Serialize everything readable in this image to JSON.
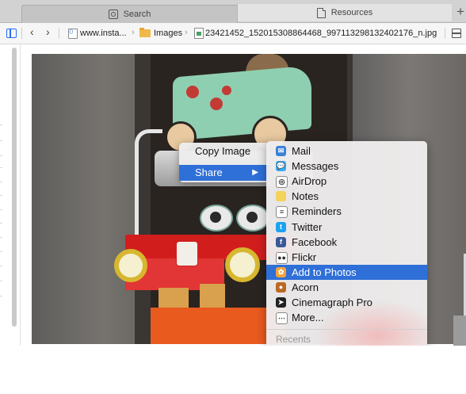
{
  "tabs": [
    {
      "label": "Search",
      "icon": "search-box-icon"
    },
    {
      "label": "Resources",
      "icon": "document-icon"
    }
  ],
  "new_tab_label": "+",
  "path": {
    "crumbs": [
      "www.insta...",
      "Images",
      "23421452_152015308864468_997113298132402176_n.jpg"
    ]
  },
  "menu_main": [
    {
      "label": "Copy Image"
    },
    {
      "label": "Share",
      "arrow": "▶"
    }
  ],
  "menu_share": [
    {
      "label": "Mail",
      "icon": "mail-icon",
      "color": "#3b82d6",
      "glyph": "✉"
    },
    {
      "label": "Messages",
      "icon": "messages-icon",
      "color": "#3fa7f0",
      "glyph": "💬"
    },
    {
      "label": "AirDrop",
      "icon": "airdrop-icon",
      "color": "#ffffff",
      "glyph": "◎"
    },
    {
      "label": "Notes",
      "icon": "notes-icon",
      "color": "#f3d35c",
      "glyph": ""
    },
    {
      "label": "Reminders",
      "icon": "reminders-icon",
      "color": "#ffffff",
      "glyph": "≡"
    },
    {
      "label": "Twitter",
      "icon": "twitter-icon",
      "color": "#1da1f2",
      "glyph": "t"
    },
    {
      "label": "Facebook",
      "icon": "facebook-icon",
      "color": "#3b5998",
      "glyph": "f"
    },
    {
      "label": "Flickr",
      "icon": "flickr-icon",
      "color": "#ffffff",
      "glyph": "●●"
    },
    {
      "label": "Add to Photos",
      "icon": "photos-icon",
      "color": "#f2a33a",
      "glyph": "✿"
    },
    {
      "label": "Acorn",
      "icon": "acorn-icon",
      "color": "#b96a24",
      "glyph": "●"
    },
    {
      "label": "Cinemagraph Pro",
      "icon": "cinemagraph-icon",
      "color": "#222222",
      "glyph": "➤"
    },
    {
      "label": "More...",
      "icon": "more-icon",
      "color": "#ffffff",
      "glyph": "⋯"
    }
  ],
  "menu_share_recents": "Recents",
  "colors": {
    "selection": "#2f6fd8",
    "accent": "#2a6df4"
  }
}
